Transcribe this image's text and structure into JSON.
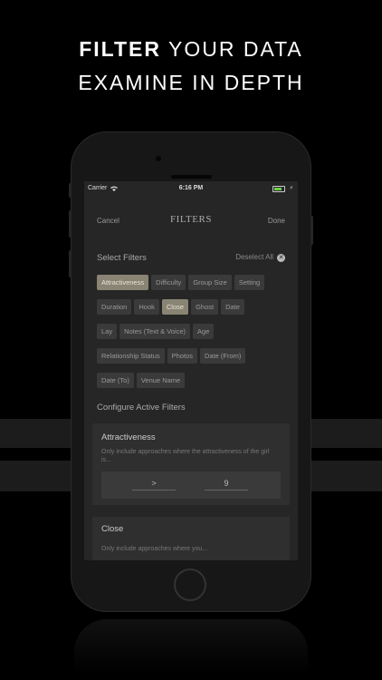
{
  "headline": {
    "line1_bold": "FILTER",
    "line1_rest": " YOUR DATA",
    "line2": "EXAMINE IN DEPTH"
  },
  "status_bar": {
    "carrier": "Carrier",
    "time": "6:16 PM",
    "wifi_icon": "wifi-icon",
    "battery_icon": "battery-icon"
  },
  "nav": {
    "cancel": "Cancel",
    "title": "FILTERS",
    "done": "Done"
  },
  "select_filters": {
    "title": "Select Filters",
    "deselect_all": "Deselect All",
    "deselect_icon": "close-circle-icon",
    "chips": [
      {
        "label": "Attractiveness",
        "active": true
      },
      {
        "label": "Difficulty",
        "active": false
      },
      {
        "label": "Group Size",
        "active": false
      },
      {
        "label": "Setting",
        "active": false
      },
      {
        "label": "Duration",
        "active": false
      },
      {
        "label": "Hook",
        "active": false
      },
      {
        "label": "Close",
        "active": true
      },
      {
        "label": "Ghost",
        "active": false
      },
      {
        "label": "Date",
        "active": false
      },
      {
        "label": "Lay",
        "active": false
      },
      {
        "label": "Notes (Text & Voice)",
        "active": false
      },
      {
        "label": "Age",
        "active": false
      },
      {
        "label": "Relationship Status",
        "active": false
      },
      {
        "label": "Photos",
        "active": false
      },
      {
        "label": "Date (From)",
        "active": false
      },
      {
        "label": "Date (To)",
        "active": false
      },
      {
        "label": "Venue Name",
        "active": false
      }
    ]
  },
  "configure": {
    "title": "Configure Active Filters",
    "cards": [
      {
        "title": "Attractiveness",
        "description": "Only include approaches where the attractiveness of the girl is...",
        "operator": ">",
        "value": "9"
      },
      {
        "title": "Close",
        "description": "Only include approaches where you..."
      }
    ]
  },
  "colors": {
    "background": "#000000",
    "screen": "#262626",
    "chip": "#3a3a3a",
    "chip_active": "#8a8474",
    "battery": "#6bd14a"
  }
}
